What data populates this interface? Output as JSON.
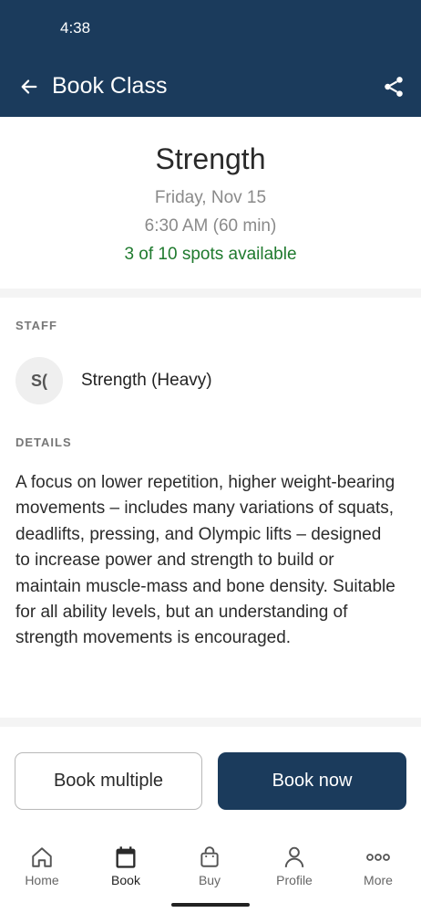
{
  "status_bar": {
    "time": "4:38"
  },
  "app_bar": {
    "title": "Book Class",
    "back_icon": "arrow-left-icon",
    "share_icon": "share-icon",
    "background": "#1b3b5c"
  },
  "class": {
    "name": "Strength",
    "date": "Friday, Nov 15",
    "time": "6:30 AM (60 min)",
    "spots": "3 of 10 spots available",
    "spots_color": "#1f7a2e"
  },
  "staff": {
    "label": "STAFF",
    "initials": "S(",
    "name": "Strength (Heavy)"
  },
  "details": {
    "label": "DETAILS",
    "text": "A focus on lower repetition, higher weight-bearing movements – includes many variations of squats, deadlifts, pressing, and Olympic lifts – designed to increase power and strength to build or maintain muscle-mass and bone density.   Suitable for all ability levels, but an understanding of strength movements is encouraged."
  },
  "actions": {
    "book_multiple": "Book multiple",
    "book_now": "Book now"
  },
  "bottom_nav": {
    "items": [
      {
        "label": "Home",
        "icon": "home-icon"
      },
      {
        "label": "Book",
        "icon": "calendar-icon",
        "active": true
      },
      {
        "label": "Buy",
        "icon": "shopping-bag-icon"
      },
      {
        "label": "Profile",
        "icon": "person-icon"
      },
      {
        "label": "More",
        "icon": "more-dots-icon"
      }
    ]
  }
}
